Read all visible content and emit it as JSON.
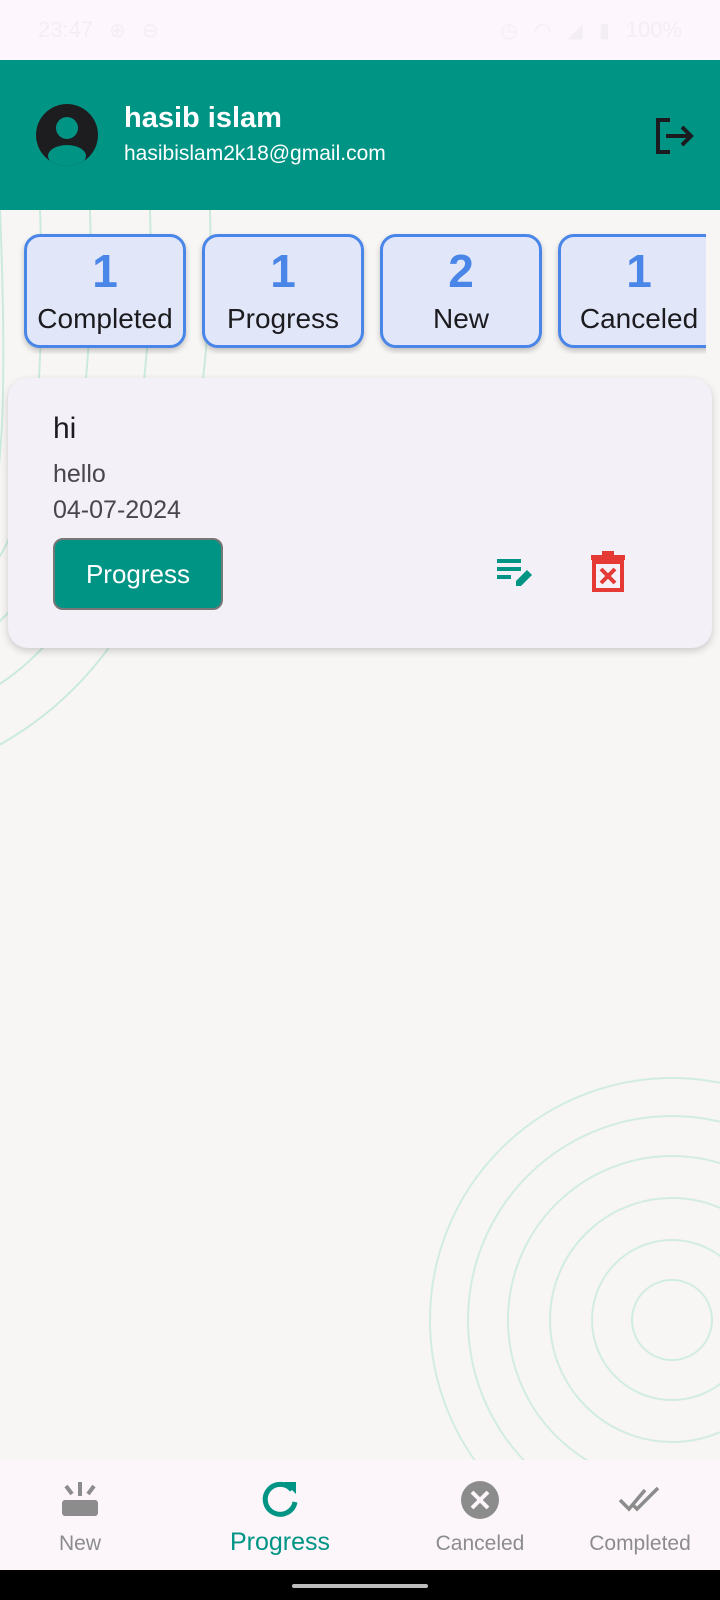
{
  "status_bar": {
    "time": "23:47",
    "battery": "100%"
  },
  "header": {
    "user_name": "hasib islam",
    "user_email": "hasibislam2k18@gmail.com",
    "avatar_icon": "person-icon",
    "logout_icon": "logout-icon",
    "background_color": "#009485"
  },
  "summary": [
    {
      "count": "1",
      "label": "Completed"
    },
    {
      "count": "1",
      "label": "Progress"
    },
    {
      "count": "2",
      "label": "New"
    },
    {
      "count": "1",
      "label": "Canceled"
    }
  ],
  "task": {
    "title": "hi",
    "description": "hello",
    "date": "04-07-2024",
    "status_label": "Progress",
    "edit_icon": "edit-icon",
    "delete_icon": "delete-icon"
  },
  "bottom_nav": {
    "items": [
      {
        "label": "New",
        "icon": "new-tasks-icon"
      },
      {
        "label": "Progress",
        "icon": "refresh-icon"
      },
      {
        "label": "Canceled",
        "icon": "cancel-icon"
      },
      {
        "label": "Completed",
        "icon": "done-all-icon"
      }
    ],
    "active": "Progress"
  },
  "colors": {
    "accent": "#009485",
    "card_border": "#4a86e8",
    "delete": "#e53935"
  }
}
